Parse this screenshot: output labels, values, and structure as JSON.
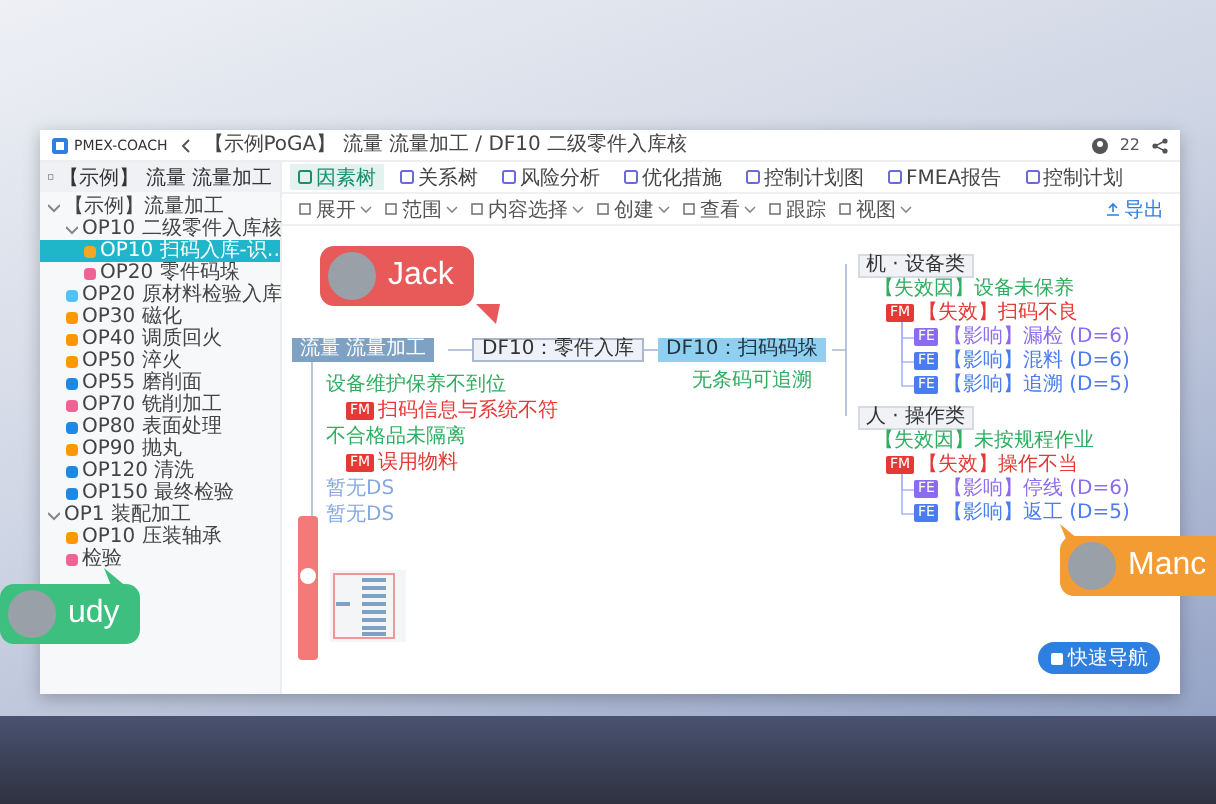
{
  "app": {
    "logo": "PMEX-COACH",
    "breadcrumb": "【示例PoGA】 流量 流量加工 / DF10 二级零件入库核",
    "online_count": "22"
  },
  "sidebar": {
    "title": "【示例】 流量 流量加工",
    "tree": [
      {
        "label": "【示例】流量加工",
        "selected": false,
        "expanded": true,
        "children": [
          {
            "label": "OP10 二级零件入库核",
            "selected": false,
            "expanded": true,
            "children": [
              {
                "label": "OP10 扫码入库-识…",
                "selected": true,
                "color": "#f5a623"
              },
              {
                "label": "OP20 零件码垛",
                "selected": false,
                "color": "#f06292"
              }
            ]
          },
          {
            "label": "OP20 原材料检验入库",
            "selected": false,
            "color": "#4fc3f7"
          },
          {
            "label": "OP30 磁化",
            "selected": false,
            "color": "#ff9800"
          },
          {
            "label": "OP40 调质回火",
            "selected": false,
            "color": "#ff9800"
          },
          {
            "label": "OP50 淬火",
            "selected": false,
            "color": "#ff9800"
          },
          {
            "label": "OP55 磨削面",
            "selected": false,
            "color": "#1e88e5"
          },
          {
            "label": "OP70 铣削加工",
            "selected": false,
            "color": "#f06292"
          },
          {
            "label": "OP80 表面处理",
            "selected": false,
            "color": "#1e88e5"
          },
          {
            "label": "OP90 抛丸",
            "selected": false,
            "color": "#ff9800"
          },
          {
            "label": "OP120 清洗",
            "selected": false,
            "color": "#1e88e5"
          },
          {
            "label": "OP150 最终检验",
            "selected": false,
            "color": "#1e88e5"
          }
        ]
      },
      {
        "label": "OP1 装配加工",
        "selected": false,
        "expanded": true,
        "children": [
          {
            "label": "OP10 压装轴承",
            "selected": false,
            "color": "#ff9800"
          },
          {
            "label": "检验",
            "selected": false,
            "color": "#f06292"
          }
        ]
      }
    ]
  },
  "tabs": [
    {
      "label": "因素树",
      "selected": true
    },
    {
      "label": "关系树",
      "selected": false
    },
    {
      "label": "风险分析",
      "selected": false
    },
    {
      "label": "优化措施",
      "selected": false
    },
    {
      "label": "控制计划图",
      "selected": false
    },
    {
      "label": "FMEA报告",
      "selected": false
    },
    {
      "label": "控制计划",
      "selected": false
    }
  ],
  "tools": [
    {
      "label": "展开",
      "dropdown": true
    },
    {
      "label": "范围",
      "dropdown": true
    },
    {
      "label": "内容选择",
      "dropdown": true
    },
    {
      "label": "创建",
      "dropdown": true
    },
    {
      "label": "查看",
      "dropdown": true
    },
    {
      "label": "跟踪",
      "dropdown": false
    },
    {
      "label": "视图",
      "dropdown": true
    }
  ],
  "export": "导出",
  "mindmap": {
    "root": "流量 流量加工",
    "function_node": "DF10：零件入库",
    "step_node": "DF10：扫码码垛",
    "step_note": "无条码可追溯",
    "left_items": [
      {
        "kind": "cause",
        "text": "设备维护保养不到位"
      },
      {
        "kind": "mode",
        "tag": "FM",
        "text": "扫码信息与系统不符"
      },
      {
        "kind": "cause",
        "text": "不合格品未隔离"
      },
      {
        "kind": "mode",
        "tag": "FM",
        "text": "误用物料"
      },
      {
        "kind": "link",
        "text": "暂无DS"
      },
      {
        "kind": "link",
        "text": "暂无DS"
      }
    ],
    "groups": [
      {
        "title": "机 · 设备类",
        "cause": "【失效因】设备未保养",
        "mode_tag": "FM",
        "mode": "【失效】扫码不良",
        "effects": [
          {
            "tag": "FE",
            "color": "#8b6cf0",
            "text": "【影响】漏检 (D=6)"
          },
          {
            "tag": "FE",
            "color": "#4a7cf0",
            "text": "【影响】混料 (D=6)"
          },
          {
            "tag": "FE",
            "color": "#4a7cf0",
            "text": "【影响】追溯 (D=5)"
          }
        ]
      },
      {
        "title": "人 · 操作类",
        "cause": "【失效因】未按规程作业",
        "mode_tag": "FM",
        "mode": "【失效】操作不当",
        "effects": [
          {
            "tag": "FE",
            "color": "#8b6cf0",
            "text": "【影响】停线 (D=6)"
          },
          {
            "tag": "FE",
            "color": "#4a7cf0",
            "text": "【影响】返工 (D=5)"
          }
        ]
      }
    ]
  },
  "collaborators": [
    {
      "name": "Jack",
      "color": "#e85a5a"
    },
    {
      "name": "udy",
      "color": "#3dc07f"
    },
    {
      "name": "Manc",
      "color": "#f39c34"
    }
  ],
  "zoom": {
    "level": 0.6
  },
  "quick_button": "快速导航"
}
